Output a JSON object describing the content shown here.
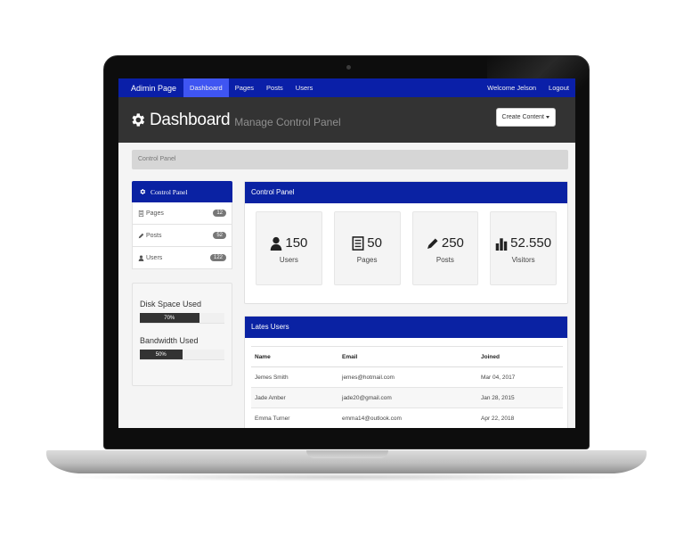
{
  "nav": {
    "brand": "Adimin Page",
    "links": [
      "Dashboard",
      "Pages",
      "Posts",
      "Users"
    ],
    "welcome": "Welcome Jelson",
    "logout": "Logout"
  },
  "header": {
    "title": "Dashboard",
    "subtitle": "Manage Control Panel",
    "create_button": "Create Content"
  },
  "breadcrumb": "Control Panel",
  "sidebar": {
    "title": "Control Panel",
    "items": [
      {
        "label": "Pages",
        "count": "12",
        "icon": "file-icon"
      },
      {
        "label": "Posts",
        "count": "52",
        "icon": "pencil-icon"
      },
      {
        "label": "Users",
        "count": "122",
        "icon": "user-icon"
      }
    ]
  },
  "usage": {
    "disk_label": "Disk Space Used",
    "disk_value": "70%",
    "disk_fraction": 0.7,
    "bandwidth_label": "Bandwidth Used",
    "bandwidth_value": "50%",
    "bandwidth_fraction": 0.5
  },
  "overview": {
    "title": "Control Panel",
    "stats": [
      {
        "value": "150",
        "label": "Users",
        "icon": "user-icon"
      },
      {
        "value": "50",
        "label": "Pages",
        "icon": "file-icon"
      },
      {
        "value": "250",
        "label": "Posts",
        "icon": "pencil-icon"
      },
      {
        "value": "52.550",
        "label": "Visitors",
        "icon": "bar-chart-icon"
      }
    ]
  },
  "latest_users": {
    "title": "Lates Users",
    "columns": [
      "Name",
      "Email",
      "Joined"
    ],
    "rows": [
      [
        "Jemes Smith",
        "jemes@hotmail.com",
        "Mar 04, 2017"
      ],
      [
        "Jade Amber",
        "jade20@gmail.com",
        "Jan 28, 2015"
      ],
      [
        "Emma Turner",
        "emma14@outlook.com",
        "Apr 22, 2018"
      ]
    ]
  },
  "colors": {
    "navbar": "#0a1fa8",
    "nav_active": "#3f55f2",
    "panel_head": "#0a22a3",
    "header_bg": "#333333"
  }
}
